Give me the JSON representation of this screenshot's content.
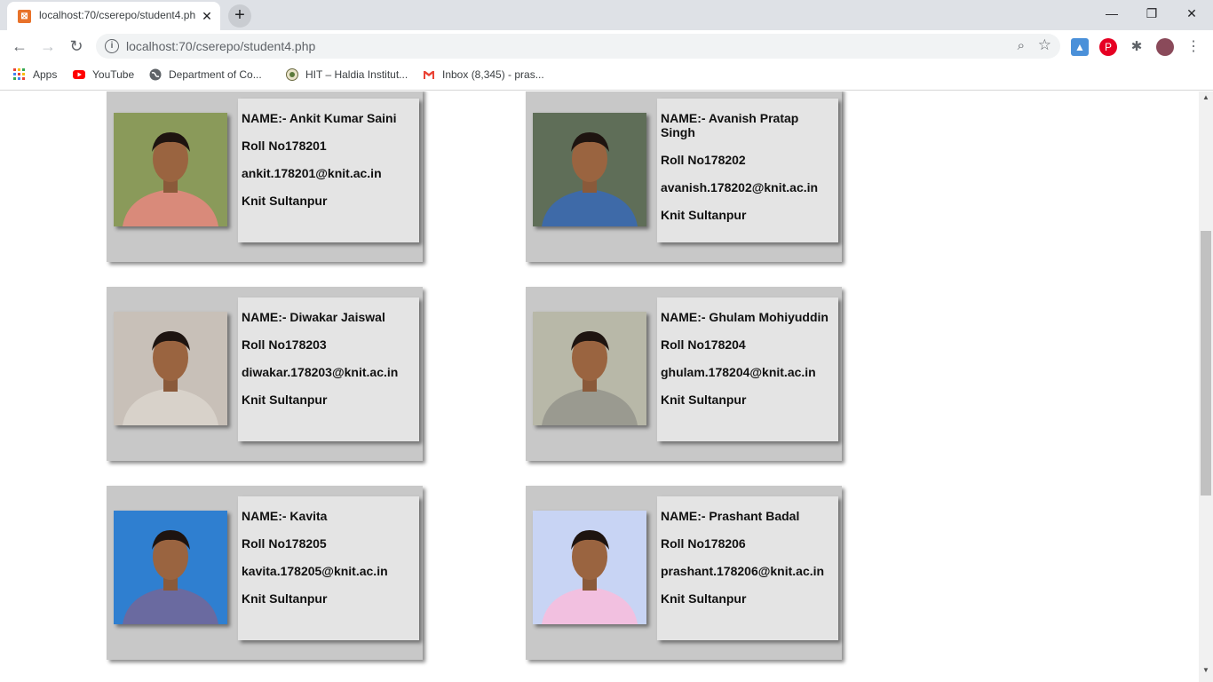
{
  "browser": {
    "tab_title": "localhost:70/cserepo/student4.ph",
    "url": "localhost:70/cserepo/student4.php",
    "bookmarks": [
      {
        "label": "Apps",
        "icon": "apps-grid-icon"
      },
      {
        "label": "YouTube",
        "icon": "youtube-icon"
      },
      {
        "label": "Department of Co...",
        "icon": "globe-icon"
      },
      {
        "label": "HIT – Haldia Institut...",
        "icon": "hit-logo-icon"
      },
      {
        "label": "Inbox (8,345) - pras...",
        "icon": "gmail-icon"
      }
    ]
  },
  "students": [
    {
      "name": "NAME:- Ankit Kumar Saini",
      "roll": "Roll No178201",
      "email": "ankit.178201@knit.ac.in",
      "college": "Knit Sultanpur",
      "photo_bg": "#8a9a5a",
      "photo_shirt": "#d98a7a"
    },
    {
      "name": "NAME:- Avanish Pratap Singh",
      "roll": "Roll No178202",
      "email": "avanish.178202@knit.ac.in",
      "college": "Knit Sultanpur",
      "photo_bg": "#5f6e58",
      "photo_shirt": "#3e6aa8"
    },
    {
      "name": "NAME:- Diwakar Jaiswal",
      "roll": "Roll No178203",
      "email": "diwakar.178203@knit.ac.in",
      "college": "Knit Sultanpur",
      "photo_bg": "#c8c0b8",
      "photo_shirt": "#d8d2ca"
    },
    {
      "name": "NAME:- Ghulam Mohiyuddin",
      "roll": "Roll No178204",
      "email": "ghulam.178204@knit.ac.in",
      "college": "Knit Sultanpur",
      "photo_bg": "#b8b8a8",
      "photo_shirt": "#9a9a90"
    },
    {
      "name": "NAME:- Kavita",
      "roll": "Roll No178205",
      "email": "kavita.178205@knit.ac.in",
      "college": "Knit Sultanpur",
      "photo_bg": "#2f7fd0",
      "photo_shirt": "#6a6aa0"
    },
    {
      "name": "NAME:- Prashant Badal",
      "roll": "Roll No178206",
      "email": "prashant.178206@knit.ac.in",
      "college": "Knit Sultanpur",
      "photo_bg": "#c8d4f4",
      "photo_shirt": "#f2c0e0"
    }
  ]
}
